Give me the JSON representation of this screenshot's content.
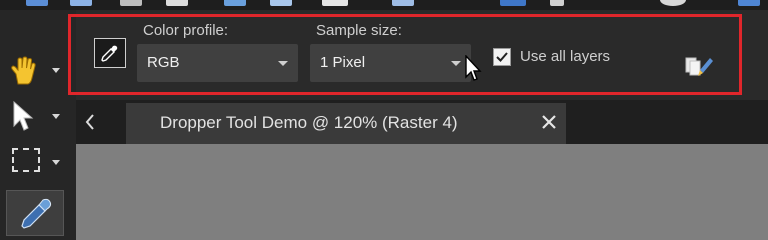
{
  "options_bar": {
    "color_profile_label": "Color profile:",
    "color_profile_value": "RGB",
    "sample_size_label": "Sample size:",
    "sample_size_value": "1 Pixel",
    "use_all_layers_label": "Use all layers",
    "use_all_layers_checked": true
  },
  "document_tab": {
    "title": "Dropper Tool Demo @ 120% (Raster 4)"
  },
  "tools": [
    {
      "name": "pan-tool",
      "icon": "hand-icon"
    },
    {
      "name": "pick-tool",
      "icon": "arrow-pointer-icon"
    },
    {
      "name": "selection-tool",
      "icon": "marquee-selection-icon"
    },
    {
      "name": "dropper-tool",
      "icon": "eyedropper-icon",
      "active": true
    }
  ],
  "colors": {
    "highlight": "#e0262b",
    "canvas": "#7f7f7f",
    "panel": "#2a2a2a"
  }
}
